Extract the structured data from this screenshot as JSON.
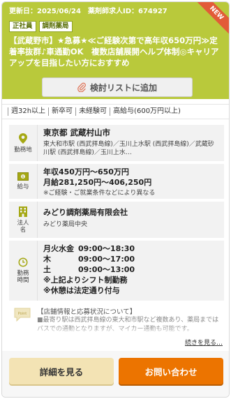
{
  "header": {
    "updated": "更新日：2025/06/24",
    "job_id": "薬剤師求人ID：674927",
    "badges": [
      "正社員",
      "調剤薬局"
    ],
    "title": "【武蔵野市】★急募★≪ご経験次第で高年収650万円≫定着率抜群♪車通勤OK　複数店舗展開ヘルプ体制◎キャリアアップを目指したい方におすすめ",
    "new_label": "NEW",
    "accent_color": "#b9c93b"
  },
  "consider_button": {
    "label": "検討リストに追加",
    "icon": "paperclip-icon"
  },
  "tags": [
    "週32h以上",
    "新卒可",
    "未経験可",
    "高給与(600万円以上)"
  ],
  "location": {
    "label": "勤務地",
    "main": "東京都 武蔵村山市",
    "sub": "東大和市駅 (西武拝島線)／玉川上水駅 (西武拝島線)／武蔵砂川駅 (西武拝島線)／玉川上水…",
    "icon": "map-pin-icon"
  },
  "salary": {
    "label": "給与",
    "annual": "年収450万円〜650万円",
    "monthly": "月給281,250円〜406,250円",
    "note": "※ご経験・ご就業条件などにより異なる",
    "icon": "money-icon"
  },
  "corporation": {
    "label": "法人名",
    "name": "みどり調剤薬局有限会社",
    "sub": "みどり薬局中央",
    "icon": "building-icon"
  },
  "hours": {
    "label": "勤務時間",
    "rows": [
      {
        "day": "月火水金",
        "time": "09:00〜18:30"
      },
      {
        "day": "木",
        "time": "09:00〜17:00"
      },
      {
        "day": "土",
        "time": "09:00〜13:00"
      }
    ],
    "notes": [
      "※上記よりシフト制勤務",
      "※休憩は法定通り付与"
    ],
    "icon": "clock-icon"
  },
  "store": {
    "title": "【店舗情報と応募状況について】",
    "text": "■最寄り駅は西武拝島線の東大和市駅など複数あり、薬局まではバスでの通勤となりますが、マイカー通勤も可能です。",
    "more": "続きを見る…",
    "icon": "speech-bubble-icon"
  },
  "buttons": {
    "detail": "詳細を見る",
    "contact": "お問い合わせ"
  }
}
